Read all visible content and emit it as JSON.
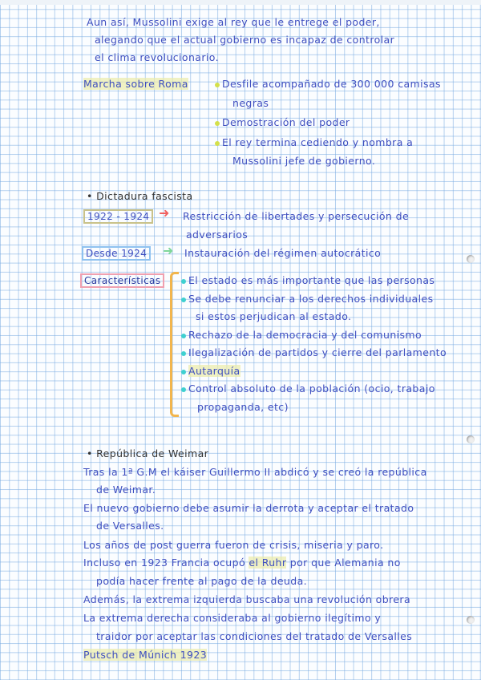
{
  "intro": [
    "Aun así, Mussolini exige al rey que le entrege el poder,",
    "alegando que el actual gobierno es incapaz de controlar",
    "el clima revolucionario."
  ],
  "marcha": {
    "label": "Marcha sobre Roma",
    "items": [
      "Desfile acompañado de 300 000 camisas",
      "negras",
      "Demostración del poder",
      "El rey termina cediendo y nombra a",
      "Mussolini jefe de gobierno."
    ]
  },
  "dictadura": {
    "heading": "Dictadura fascista",
    "period1": {
      "label": "1922 - 1924",
      "text": [
        "Restricción de libertades y persecución de",
        "adversarios"
      ]
    },
    "period2": {
      "label": "Desde 1924",
      "text": "Instauración del régimen autocrático"
    },
    "caracteristicas": {
      "label": "Características",
      "items": [
        "El estado es más importante que las personas",
        "Se debe renunciar a los derechos individuales",
        "si estos perjudican al estado.",
        "Rechazo de la democracia y del comunismo",
        "Ilegalización de partidos y cierre del parlamento",
        "Autarquía",
        "Control absoluto de la población (ocio, trabajo",
        "propaganda, etc)"
      ]
    }
  },
  "weimar": {
    "heading": "República de Weimar",
    "lines": [
      "Tras la 1ª G.M el káiser Guillermo II abdicó y se creó la república",
      "de Weimar.",
      "El nuevo gobierno debe asumir la derrota y aceptar el tratado",
      "de Versalles.",
      "Los años de post guerra fueron de crisis, miseria y paro.",
      "Incluso en 1923 Francia ocupó",
      "el Ruhr",
      "por que Alemania no",
      "podía hacer frente al pago de la deuda.",
      "Además, la extrema izquierda buscaba una revolución obrera",
      "La extrema derecha consideraba al gobierno ilegítimo y",
      "traidor por aceptar las condiciones del tratado de Versalles",
      "Putsch de Múnich 1923"
    ]
  },
  "colors": {
    "ink": "#3f4fc0",
    "yellow_bullet": "#d4e04a",
    "cyan_bullet": "#3fd0d0",
    "red_arrow": "#f06060",
    "green_arrow": "#7fd79a",
    "bracket": "#f2b54c"
  }
}
